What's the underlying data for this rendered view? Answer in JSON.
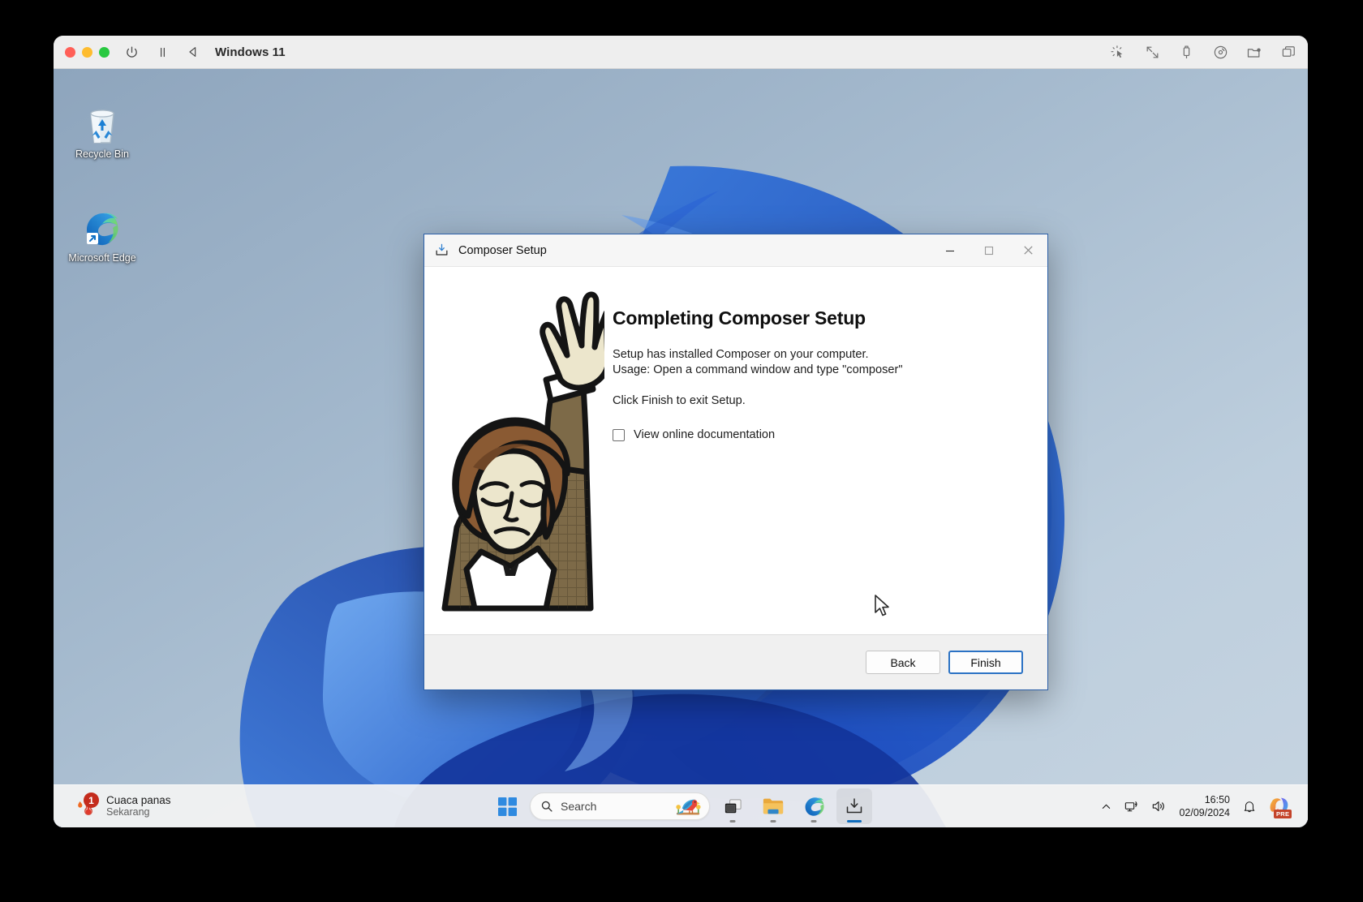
{
  "vm": {
    "title": "Windows 11",
    "controls": [
      {
        "name": "power-icon",
        "label": "Power"
      },
      {
        "name": "pause-icon",
        "label": "Pause"
      },
      {
        "name": "play-back-icon",
        "label": "Back"
      }
    ],
    "tools": [
      {
        "name": "pointer-click-icon",
        "label": "Pointer"
      },
      {
        "name": "resize-diagonal-icon",
        "label": "Resize"
      },
      {
        "name": "usb-icon",
        "label": "USB devices"
      },
      {
        "name": "disc-icon",
        "label": "CD/DVD"
      },
      {
        "name": "shared-folder-icon",
        "label": "Shared folders"
      },
      {
        "name": "windows-stack-icon",
        "label": "Unity / Windows"
      }
    ]
  },
  "desktop": {
    "icons": [
      {
        "name": "recycle-bin",
        "label": "Recycle Bin"
      },
      {
        "name": "microsoft-edge",
        "label": "Microsoft Edge"
      }
    ]
  },
  "taskbar": {
    "weather": {
      "title": "Cuaca panas",
      "subtitle": "Sekarang",
      "badge": "1"
    },
    "start": {
      "label": "Start"
    },
    "search": {
      "placeholder": "Search",
      "icon": "search-icon",
      "illustration": "parrot-illustration"
    },
    "apps": [
      {
        "name": "task-view",
        "label": "Task View"
      },
      {
        "name": "file-explorer",
        "label": "File Explorer"
      },
      {
        "name": "microsoft-edge",
        "label": "Microsoft Edge"
      },
      {
        "name": "composer-setup",
        "label": "Composer Setup"
      }
    ],
    "tray": {
      "chevron": "chevron-up-icon",
      "network": "network-icon",
      "volume": "volume-icon",
      "time": "16:50",
      "date": "02/09/2024",
      "notifications": "bell-icon",
      "copilot_badge": "PRE"
    }
  },
  "dialog": {
    "title": "Composer Setup",
    "icon": "installer-download-icon",
    "window_buttons": [
      {
        "name": "minimize-button",
        "glyph": "—"
      },
      {
        "name": "maximize-button",
        "glyph": "□"
      },
      {
        "name": "close-button",
        "glyph": "✕"
      }
    ],
    "heading": "Completing Composer Setup",
    "line1": "Setup has installed Composer on your computer.",
    "line2": "Usage: Open a command window and type \"composer\"",
    "line3": "Click Finish to exit Setup.",
    "checkbox": {
      "label": "View online documentation",
      "checked": false
    },
    "buttons": {
      "back": "Back",
      "finish": "Finish"
    },
    "colors": {
      "accent": "#2b72c4",
      "border": "#2b5fa8"
    }
  }
}
